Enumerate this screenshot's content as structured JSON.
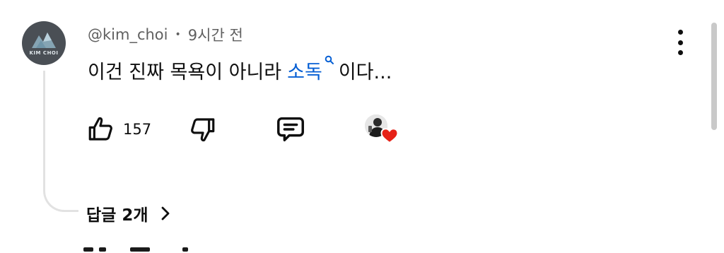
{
  "comment": {
    "author": {
      "handle": "@kim_choi",
      "avatar_text": "KIM CHOI",
      "avatar_icon": "mountain-logo-icon"
    },
    "separator": "•",
    "timestamp": "9시간 전",
    "text_before": "이건 진짜 목욕이 아니라",
    "search_link": {
      "label": "소독",
      "icon": "search-icon"
    },
    "text_after": "이다...",
    "actions": {
      "like_icon": "thumbs-up-icon",
      "like_count": "157",
      "dislike_icon": "thumbs-down-icon",
      "reply_icon": "comment-icon",
      "hearted_badge_icon": "creator-heart-icon"
    },
    "more_icon": "more-vertical-icon"
  },
  "replies": {
    "label": "답글 2개",
    "icon": "chevron-right-icon"
  },
  "colors": {
    "link": "#065fd4",
    "heart": "#e62117",
    "text": "#0f0f0f",
    "secondary_text": "#606060"
  }
}
